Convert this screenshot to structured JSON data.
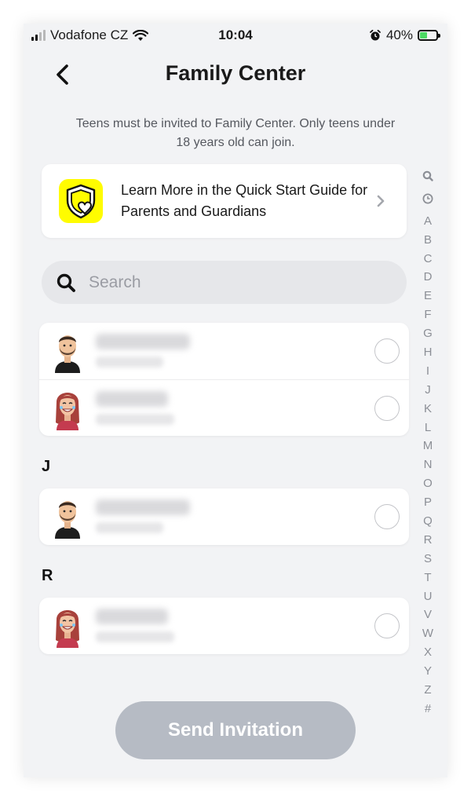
{
  "status_bar": {
    "carrier": "Vodafone CZ",
    "time": "10:04",
    "battery": "40%",
    "battery_level": 0.4
  },
  "header": {
    "title": "Family Center",
    "subtitle": "Teens must be invited to Family Center. Only teens under 18 years old can join."
  },
  "guide_card": {
    "text": "Learn More in the Quick Start Guide for Parents and Guardians",
    "icon": "shield-heart-icon"
  },
  "search": {
    "placeholder": "Search",
    "value": ""
  },
  "sections": [
    {
      "letter": "",
      "contacts": [
        {
          "avatar": "male-avatar",
          "selected": false
        },
        {
          "avatar": "female-avatar",
          "selected": false
        }
      ]
    },
    {
      "letter": "J",
      "contacts": [
        {
          "avatar": "male-avatar",
          "selected": false
        }
      ]
    },
    {
      "letter": "R",
      "contacts": [
        {
          "avatar": "female-avatar",
          "selected": false
        }
      ]
    }
  ],
  "alpha_index": [
    "search-icon",
    "clock-icon",
    "A",
    "B",
    "C",
    "D",
    "E",
    "F",
    "G",
    "H",
    "I",
    "J",
    "K",
    "L",
    "M",
    "N",
    "O",
    "P",
    "Q",
    "R",
    "S",
    "T",
    "U",
    "V",
    "W",
    "X",
    "Y",
    "Z",
    "#"
  ],
  "send_button": {
    "label": "Send Invitation",
    "enabled": false
  },
  "colors": {
    "background": "#f2f3f5",
    "card": "#ffffff",
    "accent_yellow": "#fffc00",
    "button_disabled": "#b6bbc4",
    "battery_green": "#4cd964"
  }
}
